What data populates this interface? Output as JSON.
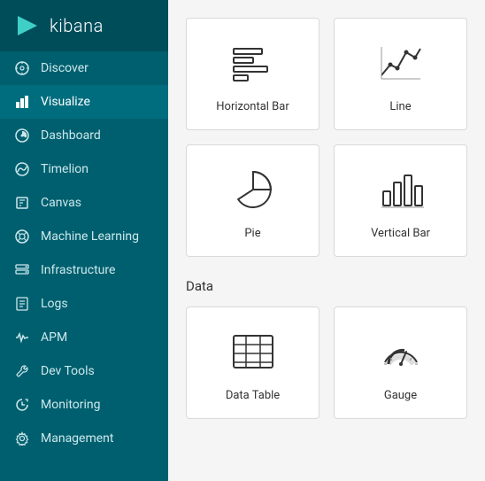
{
  "app": {
    "name": "kibana"
  },
  "sidebar": {
    "items": [
      {
        "id": "discover",
        "label": "Discover",
        "icon": "compass"
      },
      {
        "id": "visualize",
        "label": "Visualize",
        "icon": "bar-chart",
        "active": true
      },
      {
        "id": "dashboard",
        "label": "Dashboard",
        "icon": "dashboard"
      },
      {
        "id": "timelion",
        "label": "Timelion",
        "icon": "timelion"
      },
      {
        "id": "canvas",
        "label": "Canvas",
        "icon": "canvas"
      },
      {
        "id": "machine-learning",
        "label": "Machine Learning",
        "icon": "ml"
      },
      {
        "id": "infrastructure",
        "label": "Infrastructure",
        "icon": "infrastructure"
      },
      {
        "id": "logs",
        "label": "Logs",
        "icon": "logs"
      },
      {
        "id": "apm",
        "label": "APM",
        "icon": "apm"
      },
      {
        "id": "dev-tools",
        "label": "Dev Tools",
        "icon": "wrench"
      },
      {
        "id": "monitoring",
        "label": "Monitoring",
        "icon": "monitoring"
      },
      {
        "id": "management",
        "label": "Management",
        "icon": "gear"
      }
    ]
  },
  "main": {
    "basic_section_label": "",
    "data_section_label": "Data",
    "visualizations": [
      {
        "id": "horizontal-bar",
        "label": "Horizontal Bar"
      },
      {
        "id": "line",
        "label": "Line"
      },
      {
        "id": "pie",
        "label": "Pie"
      },
      {
        "id": "vertical-bar",
        "label": "Vertical Bar"
      }
    ],
    "data_visualizations": [
      {
        "id": "data-table",
        "label": "Data Table"
      },
      {
        "id": "gauge",
        "label": "Gauge"
      }
    ]
  }
}
